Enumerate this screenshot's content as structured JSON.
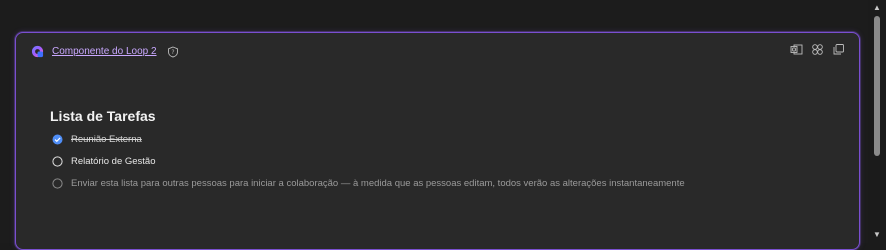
{
  "component": {
    "title": "Componente do Loop 2",
    "logo_icon": "loop-logo-icon",
    "help_icon": "question-shield-icon"
  },
  "toolbar": {
    "icons": [
      "outlook-icon",
      "apps-icon",
      "copy-icon"
    ]
  },
  "list": {
    "title": "Lista de Tarefas",
    "items": [
      {
        "text": "Reunião Externa",
        "checked": true
      },
      {
        "text": "Relatório de Gestão",
        "checked": false
      }
    ],
    "hint": "Enviar esta lista para outras pessoas para iniciar a colaboração — à medida que as pessoas editam, todos verão as alterações instantaneamente"
  },
  "colors": {
    "accent": "#7a4fd0",
    "link": "#c9a8ff",
    "check": "#4f8ef7"
  }
}
